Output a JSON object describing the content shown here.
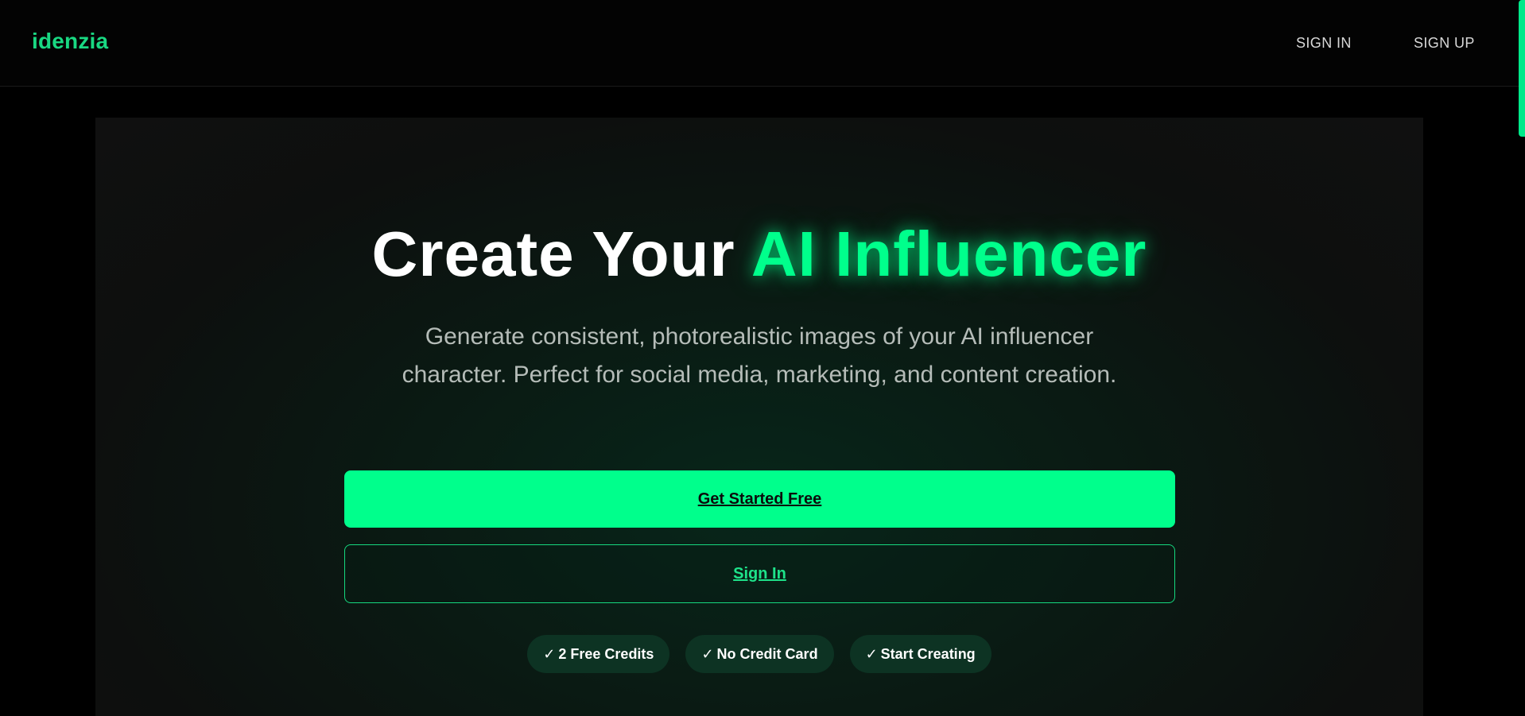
{
  "nav": {
    "brand": "idenzia",
    "signin": "SIGN IN",
    "signup": "SIGN UP"
  },
  "hero": {
    "headline_main": "Create Your",
    "headline_accent": "AI Influencer",
    "subtitle": "Generate consistent, photorealistic images of your AI influencer character. Perfect for social media, marketing, and content creation.",
    "cta_primary": "Get Started Free",
    "cta_secondary": "Sign In",
    "badges": [
      {
        "check": "✓",
        "label": "2 Free Credits"
      },
      {
        "check": "✓",
        "label": "No Credit Card"
      },
      {
        "check": "✓",
        "label": "Start Creating"
      }
    ]
  },
  "colors": {
    "accent": "#00ff8c",
    "brand": "#19d882",
    "background": "#000000",
    "badge_bg": "#0d3323"
  },
  "icons": {
    "badge_check": "check-icon"
  }
}
